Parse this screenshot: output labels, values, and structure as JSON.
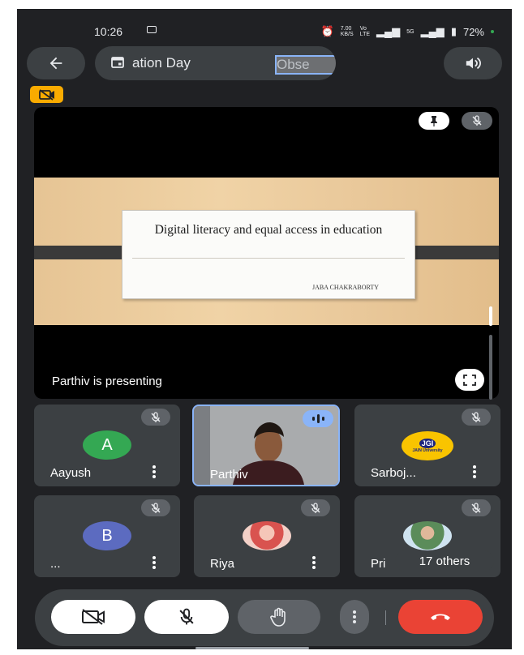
{
  "status_bar": {
    "time": "10:26",
    "network_speed_value": "7.00",
    "network_speed_unit": "KB/S",
    "vo_label": "Vo",
    "lte_label": "LTE",
    "signal_label": "5G",
    "battery": "72%"
  },
  "meeting": {
    "title_left": "ation Day",
    "title_right": "Obse"
  },
  "presentation": {
    "slide_title": "Digital literacy and equal access in education",
    "slide_author": "JABA CHAKRABORTY",
    "presenting_text": "Parthiv is presenting"
  },
  "participants": [
    {
      "name": "Aayush",
      "initial": "A",
      "avatar_color": "#34a853"
    },
    {
      "name": "Parthiv",
      "speaking": true
    },
    {
      "name": "Sarboj...",
      "logo_text": "JGI",
      "logo_subtext": "JAIN University"
    },
    {
      "name": "...",
      "initial": "B",
      "avatar_color": "#5c6bc0"
    },
    {
      "name": "Riya"
    },
    {
      "name": "Pri",
      "others_label": "17 others"
    }
  ],
  "colors": {
    "background": "#202124",
    "surface": "#3c4043",
    "accent_blue": "#8ab4f8",
    "hangup_red": "#ea4335",
    "rec_yellow": "#f9ab00"
  },
  "icons": [
    "back-arrow-icon",
    "calendar-icon",
    "speaker-icon",
    "recording-off-icon",
    "pin-icon",
    "mic-off-icon",
    "fullscreen-icon",
    "more-vert-icon",
    "camera-off-icon",
    "hand-raise-icon",
    "hang-up-icon"
  ]
}
